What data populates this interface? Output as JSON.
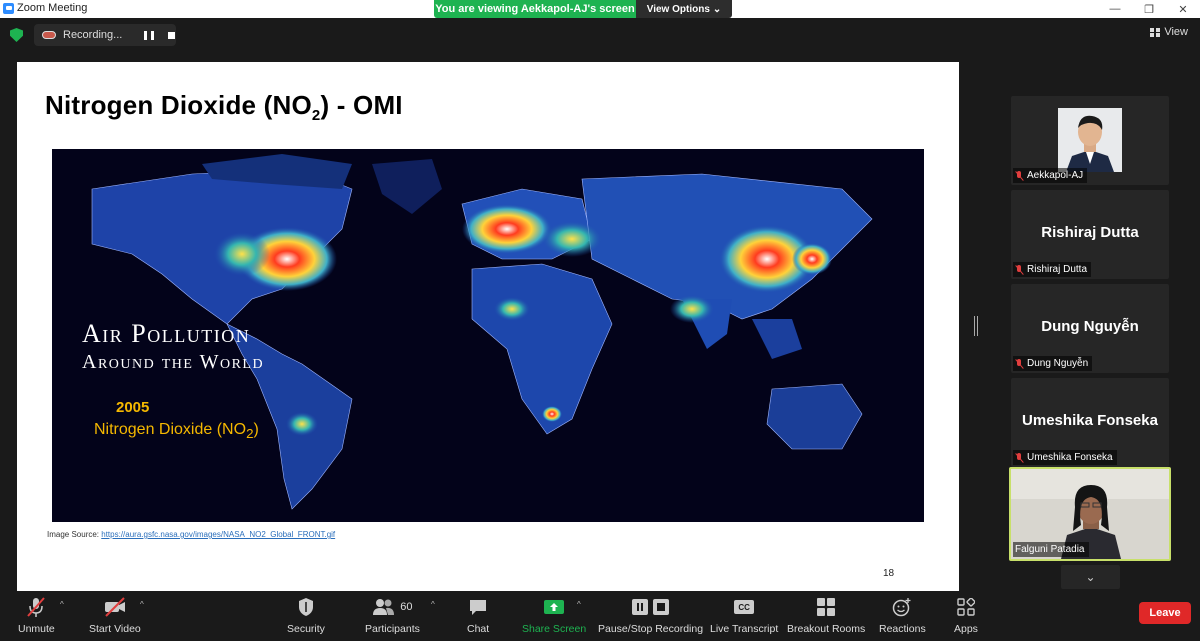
{
  "window": {
    "title": "Zoom Meeting"
  },
  "banner": {
    "viewing": "You are viewing Aekkapol-AJ's screen",
    "view_options": "View Options"
  },
  "recording": {
    "label": "Recording..."
  },
  "top_view_label": "View",
  "slide": {
    "title_main": "Nitrogen Dioxide (NO",
    "title_sub": "2",
    "title_end": ") - OMI",
    "map_caption_line1": "Air Pollution",
    "map_caption_line2": "Around the World",
    "map_year": "2005",
    "map_no2_label": "Nitrogen Dioxide (NO",
    "map_no2_sub": "2",
    "map_no2_end": ")",
    "image_source_label": "Image Source: ",
    "image_source_url": "https://aura.gsfc.nasa.gov/images/NASA_NO2_Global_FRONT.gif",
    "page_number": "18"
  },
  "participants": [
    {
      "name": "Aekkapol-AJ",
      "display": "",
      "muted": true
    },
    {
      "name": "Rishiraj Dutta",
      "display": "Rishiraj Dutta",
      "muted": true
    },
    {
      "name": "Dung Nguyễn",
      "display": "Dung Nguyễn",
      "muted": true
    },
    {
      "name": "Umeshika Fonseka",
      "display": "Umeshika Fonseka",
      "muted": true
    },
    {
      "name": "Falguni Patadia",
      "display": "",
      "muted": false
    }
  ],
  "toolbar": {
    "unmute": "Unmute",
    "start_video": "Start Video",
    "security": "Security",
    "participants": "Participants",
    "participants_count": "60",
    "chat": "Chat",
    "share_screen": "Share Screen",
    "pause_stop_recording": "Pause/Stop Recording",
    "live_transcript": "Live Transcript",
    "cc_badge": "CC",
    "breakout_rooms": "Breakout Rooms",
    "reactions": "Reactions",
    "apps": "Apps",
    "leave": "Leave"
  },
  "colors": {
    "share_green": "#1eb351",
    "leave_red": "#e02828",
    "active_speaker": "#c8e06a"
  }
}
